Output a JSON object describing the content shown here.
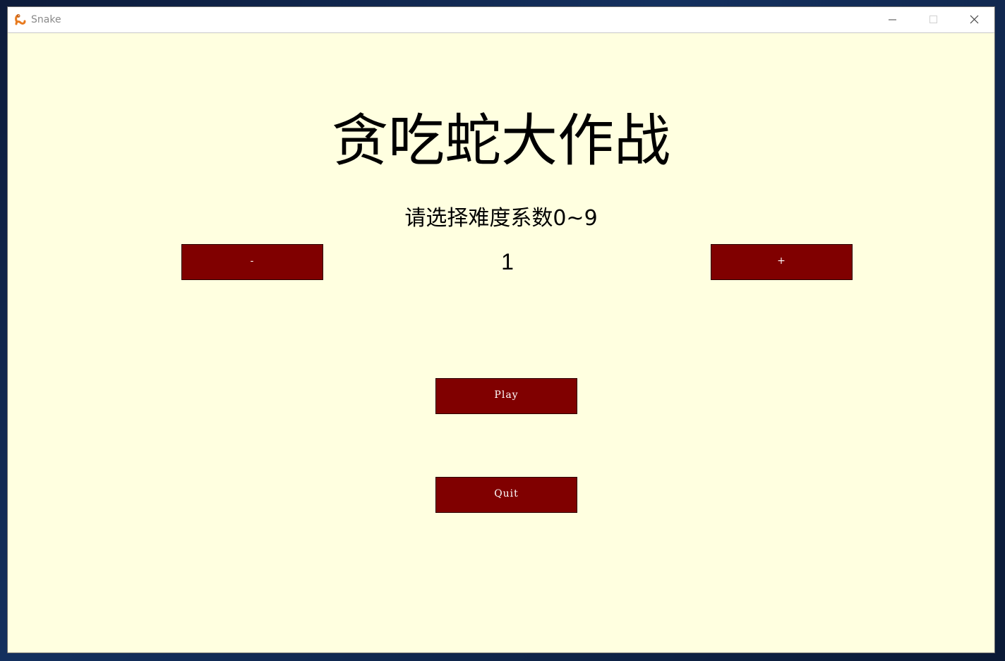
{
  "window": {
    "title": "Snake",
    "controls": {
      "minimize": "minimize-icon",
      "maximize": "maximize-icon",
      "close": "close-icon"
    }
  },
  "game": {
    "title": "贪吃蛇大作战",
    "difficulty_prompt": "请选择难度系数0~9",
    "difficulty_value": "1",
    "difficulty_range": [
      0,
      9
    ]
  },
  "buttons": {
    "decrease_label": "-",
    "increase_label": "+",
    "play_label": "Play",
    "quit_label": "Quit"
  },
  "colors": {
    "background": "#ffffe0",
    "button_fill": "#800000",
    "button_text": "#ffffff",
    "text": "#000000"
  }
}
